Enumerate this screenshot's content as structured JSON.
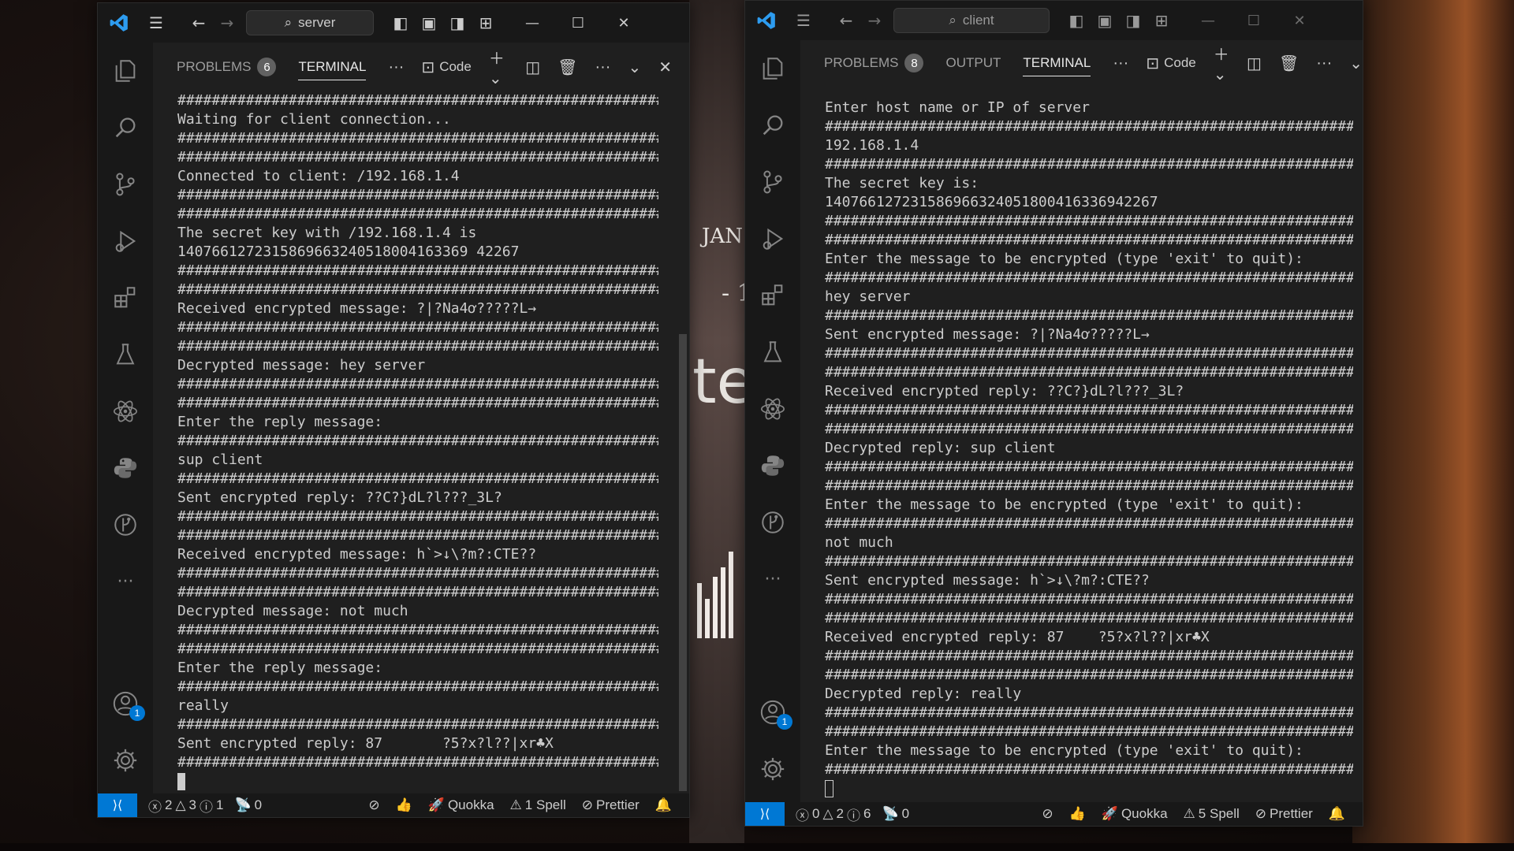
{
  "wallpaper": {
    "snippet_top": "JAN",
    "snippet_mid": "- 1",
    "snippet_big": "te"
  },
  "server": {
    "title_search": "server",
    "tabs": [
      {
        "label": "PROBLEMS",
        "count": "6"
      },
      {
        "label": "TERMINAL"
      }
    ],
    "terminal_profile": "Code",
    "account_badge": "1",
    "lines": [
      "##############################################################",
      "Waiting for client connection...",
      "##############################################################",
      "##############################################################",
      "Connected to client: /192.168.1.4",
      "##############################################################",
      "##############################################################",
      "The secret key with /192.168.1.4 is",
      "1407661272315869663240518004163369 42267",
      "##############################################################",
      "##############################################################",
      "Received encrypted message: ?|?Na4ơ?????L→",
      "##############################################################",
      "##############################################################",
      "Decrypted message: hey server",
      "##############################################################",
      "##############################################################",
      "Enter the reply message:",
      "##############################################################",
      "sup client",
      "##############################################################",
      "Sent encrypted reply: ??C?}dL?l???_3L?",
      "##############################################################",
      "##############################################################",
      "Received encrypted message: h`>↓\\?m?:CTE??",
      "##############################################################",
      "##############################################################",
      "Decrypted message: not much",
      "##############################################################",
      "##############################################################",
      "Enter the reply message:",
      "##############################################################",
      "really",
      "##############################################################",
      "Sent encrypted reply: 87       ?5?x?l??|xr♣X",
      "##############################################################"
    ],
    "status": {
      "errors": "2",
      "warnings": "3",
      "info": "1",
      "ports": "0",
      "quokka": "Quokka",
      "spell": "1 Spell",
      "prettier": "Prettier"
    }
  },
  "client": {
    "title_search": "client",
    "tabs": [
      {
        "label": "PROBLEMS",
        "count": "8"
      },
      {
        "label": "OUTPUT"
      },
      {
        "label": "TERMINAL"
      }
    ],
    "terminal_profile": "Code",
    "account_badge": "1",
    "lines": [
      "Enter host name or IP of server",
      "##############################################################",
      "192.168.1.4",
      "##############################################################",
      "The secret key is:",
      "140766127231586966324051800416336942267",
      "##############################################################",
      "##############################################################",
      "Enter the message to be encrypted (type 'exit' to quit):",
      "##############################################################",
      "hey server",
      "##############################################################",
      "Sent encrypted message: ?|?Na4ơ?????L→",
      "##############################################################",
      "##############################################################",
      "Received encrypted reply: ??C?}dL?l???_3L?",
      "##############################################################",
      "##############################################################",
      "Decrypted reply: sup client",
      "##############################################################",
      "##############################################################",
      "Enter the message to be encrypted (type 'exit' to quit):",
      "##############################################################",
      "not much",
      "##############################################################",
      "Sent encrypted message: h`>↓\\?m?:CTE??",
      "##############################################################",
      "##############################################################",
      "Received encrypted reply: 87    ?5?x?l??|xr♣X",
      "##############################################################",
      "##############################################################",
      "Decrypted reply: really",
      "##############################################################",
      "##############################################################",
      "Enter the message to be encrypted (type 'exit' to quit):",
      "##############################################################"
    ],
    "status": {
      "errors": "0",
      "warnings": "2",
      "info": "6",
      "ports": "0",
      "quokka": "Quokka",
      "spell": "5 Spell",
      "prettier": "Prettier"
    }
  },
  "colors": {
    "accent": "#0078d4",
    "editor_bg": "#1f1f1f",
    "chrome_bg": "#181818",
    "text": "#cccccc"
  }
}
